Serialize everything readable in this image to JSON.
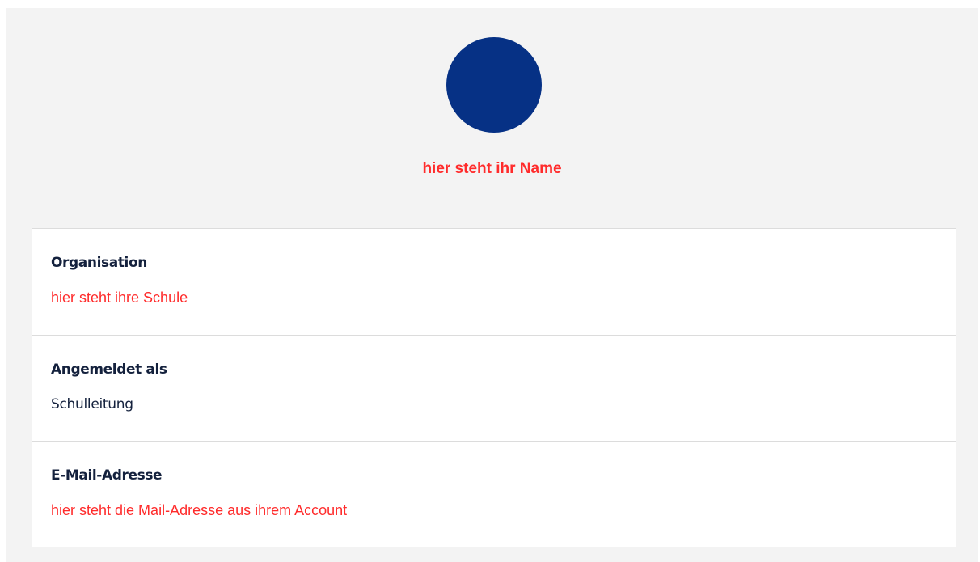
{
  "profile": {
    "name": "hier steht ihr Name",
    "avatar_color": "#063185",
    "accent_color": "#ff2b2b"
  },
  "fields": [
    {
      "label": "Organisation",
      "value": "hier steht ihre Schule"
    },
    {
      "label": "Angemeldet als",
      "value": "Schulleitung"
    },
    {
      "label": "E-Mail-Adresse",
      "value": "hier steht die Mail-Adresse aus ihrem Account"
    }
  ]
}
